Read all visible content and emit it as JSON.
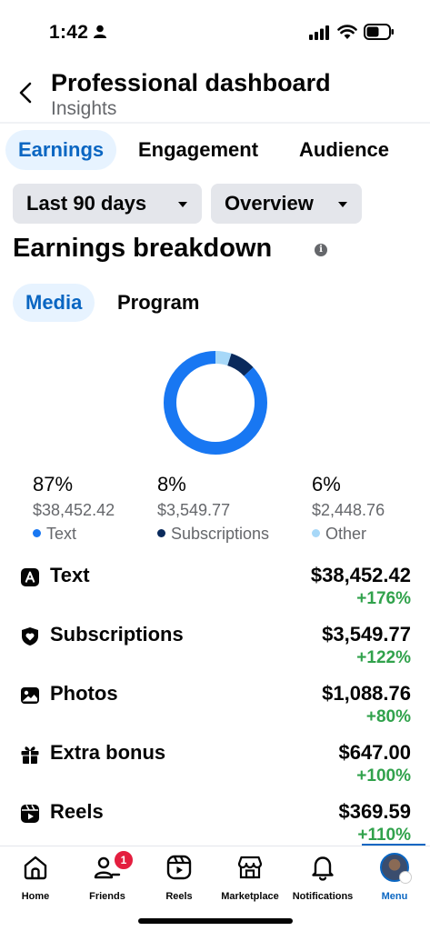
{
  "status_bar": {
    "time": "1:42"
  },
  "header": {
    "title": "Professional dashboard",
    "subtitle": "Insights"
  },
  "tabs": [
    {
      "label": "Earnings",
      "active": true
    },
    {
      "label": "Engagement",
      "active": false
    },
    {
      "label": "Audience",
      "active": false
    }
  ],
  "filters": {
    "range": "Last 90 days",
    "view": "Overview"
  },
  "section": {
    "title": "Earnings breakdown"
  },
  "subtabs": [
    {
      "label": "Media",
      "active": true
    },
    {
      "label": "Program",
      "active": false
    }
  ],
  "breakdown": [
    {
      "percent": "87%",
      "amount": "$38,452.42",
      "legend": "Text",
      "color": "#1877f2",
      "share": 0.87
    },
    {
      "percent": "8%",
      "amount": "$3,549.77",
      "legend": "Subscriptions",
      "color": "#0a2a5c",
      "share": 0.08
    },
    {
      "percent": "6%",
      "amount": "$2,448.76",
      "legend": "Other",
      "color": "#a7d8f8",
      "share": 0.05
    }
  ],
  "rows": [
    {
      "icon": "text-a-icon",
      "label": "Text",
      "value": "$38,452.42",
      "change": "+176%"
    },
    {
      "icon": "subscription-shield-icon",
      "label": "Subscriptions",
      "value": "$3,549.77",
      "change": "+122%"
    },
    {
      "icon": "photo-icon",
      "label": "Photos",
      "value": "$1,088.76",
      "change": "+80%"
    },
    {
      "icon": "gift-icon",
      "label": "Extra bonus",
      "value": "$647.00",
      "change": "+100%"
    },
    {
      "icon": "reels-icon",
      "label": "Reels",
      "value": "$369.59",
      "change": "+110%"
    }
  ],
  "nav": {
    "home": "Home",
    "friends": "Friends",
    "friends_badge": "1",
    "reels": "Reels",
    "marketplace": "Marketplace",
    "notifications": "Notifications",
    "menu": "Menu"
  },
  "colors": {
    "accent": "#0a66c2",
    "positive": "#31a24c"
  }
}
